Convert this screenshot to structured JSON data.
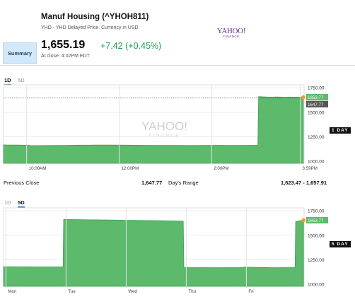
{
  "header": {
    "title": "Manuf Housing (^YHOH811)",
    "subtitle": "YHD - YHD Delayed Price. Currency in USD",
    "logo_main": "YAHOO!",
    "logo_sub": "FINANCE"
  },
  "nav": {
    "summary_label": "Summary"
  },
  "quote": {
    "price": "1,655.19",
    "change": "+7.42 (+0.45%)",
    "close_time": "At close: 4:02PM EDT",
    "change_color": "#1aa354"
  },
  "chart1": {
    "tabs": [
      "1D",
      "5D"
    ],
    "active_tab": "1D",
    "side_badge": "1 DAY",
    "watermark_main": "YAHOO!",
    "watermark_sub": "FINANCE",
    "current_label": "1653.77",
    "prev_close_label": "1647.77"
  },
  "chart2": {
    "tabs": [
      "1D",
      "5D"
    ],
    "active_tab": "5D",
    "side_badge": "5 DAY",
    "current_label": "1653.77"
  },
  "stats": {
    "prev_close_label": "Previous Close",
    "prev_close_value": "1,647.77",
    "days_range_label": "Day's Range",
    "days_range_value": "1,623.47 - 1,657.91"
  },
  "chart_data": [
    {
      "type": "area",
      "title": "",
      "color": "#5db96b",
      "ylim": [
        980,
        1780
      ],
      "yticks": [
        1000,
        1250,
        1500,
        1750
      ],
      "ytick_labels": [
        "1000.00",
        "1250.00",
        "1500.00",
        "1750.00"
      ],
      "xlim": [
        0,
        390
      ],
      "xticks": [
        {
          "x": 30,
          "label": "10:00AM"
        },
        {
          "x": 150,
          "label": "12:00PM"
        },
        {
          "x": 270,
          "label": "2:00PM"
        },
        {
          "x": 385,
          "label": "3:59PM"
        }
      ],
      "prev_close": 1647.77,
      "last": 1653.77,
      "series": [
        {
          "x": [
            0,
            5,
            15,
            25,
            35,
            45,
            60,
            80,
            100,
            120,
            140,
            160,
            180,
            200,
            220,
            240,
            260,
            280,
            300,
            320,
            330,
            331,
            335,
            345,
            355,
            365,
            375,
            385,
            389
          ],
          "y": [
            1168,
            1166,
            1166,
            1165,
            1162,
            1161,
            1162,
            1163,
            1165,
            1166,
            1166,
            1165,
            1164,
            1163,
            1163,
            1162,
            1163,
            1164,
            1163,
            1164,
            1164,
            1660,
            1658,
            1655,
            1656,
            1654,
            1655,
            1654,
            1653.77
          ]
        }
      ]
    },
    {
      "type": "area",
      "title": "",
      "color": "#5db96b",
      "ylim": [
        980,
        1780
      ],
      "yticks": [
        1000,
        1250,
        1500,
        1750
      ],
      "ytick_labels": [
        "1000.00",
        "1250.00",
        "1500.00",
        "1750.00"
      ],
      "xlim": [
        0,
        5
      ],
      "xticks": [
        {
          "x": 0.04,
          "label": "Mon"
        },
        {
          "x": 1.04,
          "label": "Tue"
        },
        {
          "x": 2.04,
          "label": "Wed"
        },
        {
          "x": 3.04,
          "label": "Thu"
        },
        {
          "x": 4.04,
          "label": "Fri"
        }
      ],
      "last": 1653.77,
      "series": [
        {
          "x": [
            0,
            0.5,
            0.99,
            1.0,
            1.5,
            1.99,
            2.0,
            2.5,
            2.99,
            3.0,
            3.5,
            3.99,
            4.0,
            4.5,
            4.85,
            4.86,
            4.93,
            4.99
          ],
          "y": [
            1180,
            1178,
            1178,
            1662,
            1658,
            1655,
            1654,
            1650,
            1645,
            1172,
            1170,
            1172,
            1175,
            1170,
            1172,
            1640,
            1648,
            1653.77
          ]
        }
      ]
    }
  ]
}
